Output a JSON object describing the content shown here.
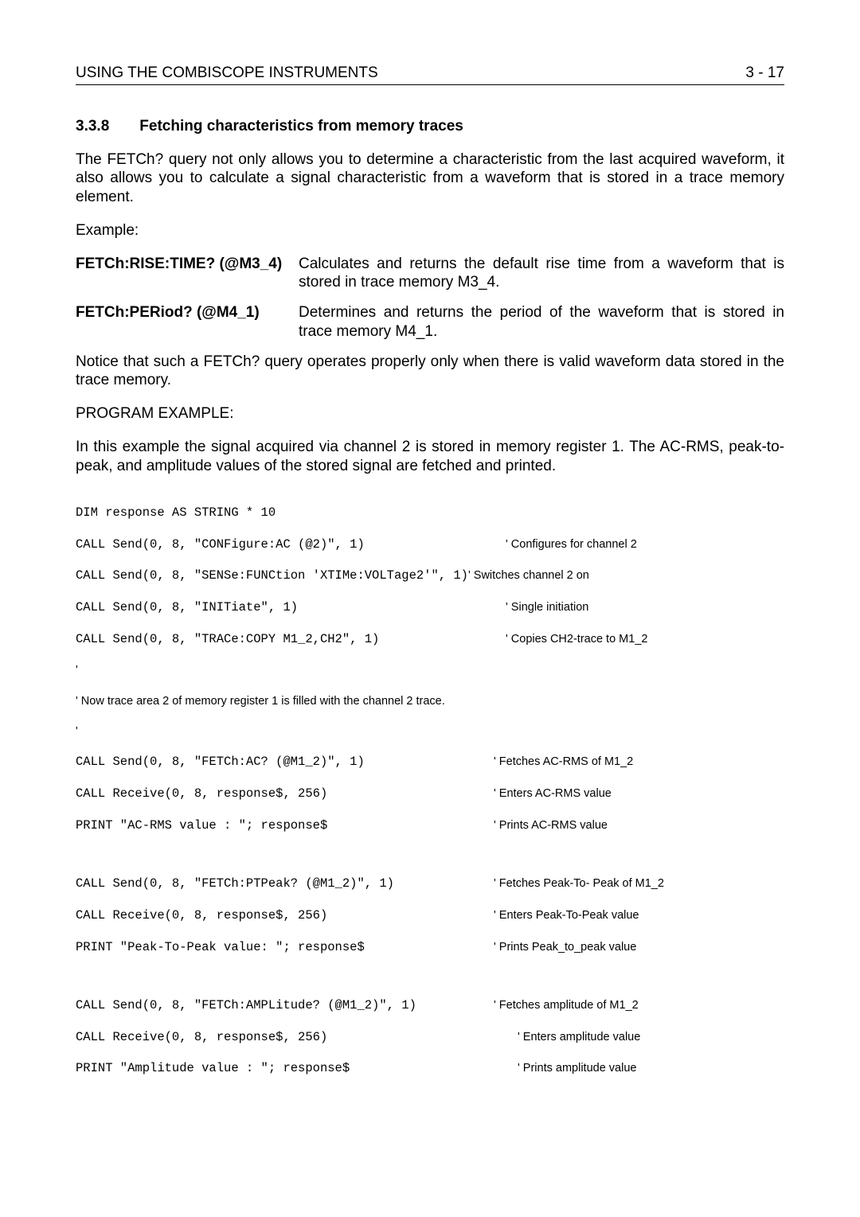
{
  "header": {
    "left": "USING THE COMBISCOPE INSTRUMENTS",
    "right": "3 - 17"
  },
  "section": {
    "num": "3.3.8",
    "title": "Fetching characteristics from memory traces"
  },
  "p1": "The FETCh? query not only allows you to determine a characteristic from the last acquired waveform, it also allows you to calculate a signal characteristic from a waveform that is stored in a trace memory element.",
  "example_label": "Example:",
  "def1": {
    "term": "FETCh:RISE:TIME? (@M3_4)",
    "desc": "Calculates and returns the default rise time from a waveform that is stored in trace memory M3_4."
  },
  "def2": {
    "term": "FETCh:PERiod? (@M4_1)",
    "desc": "Determines and returns the period of the waveform that is stored in trace memory M4_1."
  },
  "p2": "Notice that such a FETCh? query operates properly only when there is valid waveform data stored in the trace memory.",
  "prog_label": "PROGRAM EXAMPLE:",
  "p3": "In this example the signal acquired via channel 2 is stored in memory register 1. The AC-RMS, peak-to-peak, and amplitude values of the stored signal are fetched and printed.",
  "code": {
    "l1": "DIM response AS STRING * 10",
    "l2a": "CALL Send(0, 8, \"CONFigure:AC (@2)\", 1)",
    "l2b": "' Configures for channel 2",
    "l3a": "CALL Send(0, 8, \"SENSe:FUNCtion 'XTIMe:VOLTage2'\", 1)",
    "l3b": "' Switches channel 2 on",
    "l4a": "CALL Send(0, 8, \"INITiate\", 1)",
    "l4b": "' Single initiation",
    "l5a": "CALL Send(0, 8, \"TRACe:COPY M1_2,CH2\", 1)",
    "l5b": "' Copies CH2-trace to M1_2",
    "l6": "'",
    "l7": "' Now trace area 2 of memory register 1 is filled with the channel 2 trace.",
    "l8": "'",
    "l9a": "CALL Send(0, 8, \"FETCh:AC? (@M1_2)\", 1)",
    "l9b": "' Fetches AC-RMS of M1_2",
    "l10a": "CALL Receive(0, 8, response$, 256)",
    "l10b": "' Enters AC-RMS value",
    "l11a": "PRINT \"AC-RMS value : \"; response$",
    "l11b": "' Prints AC-RMS value",
    "l12a": "CALL Send(0, 8, \"FETCh:PTPeak? (@M1_2)\", 1)",
    "l12b": "' Fetches Peak-To- Peak of M1_2",
    "l13a": "CALL Receive(0, 8, response$, 256)",
    "l13b": "' Enters Peak-To-Peak value",
    "l14a": "PRINT \"Peak-To-Peak value: \"; response$",
    "l14b": "' Prints Peak_to_peak value",
    "l15a": "CALL Send(0, 8, \"FETCh:AMPLitude? (@M1_2)\", 1)",
    "l15b": "' Fetches amplitude of M1_2",
    "l16a": "CALL Receive(0, 8, response$, 256)",
    "l16b": "' Enters amplitude value",
    "l17a": "PRINT \"Amplitude value : \"; response$",
    "l17b": "' Prints amplitude value"
  }
}
